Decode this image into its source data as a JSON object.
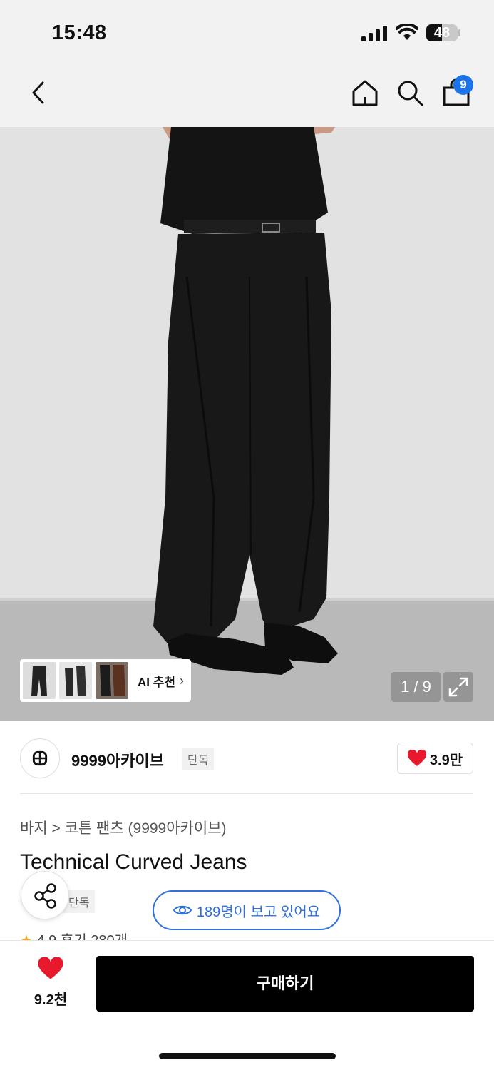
{
  "status_bar": {
    "time": "15:48",
    "battery": "48"
  },
  "nav": {
    "cart_count": "9",
    "icons": [
      "back-icon",
      "home-icon",
      "search-icon",
      "cart-icon"
    ]
  },
  "gallery": {
    "ai_label": "AI 추천",
    "counter": "1 / 9"
  },
  "brand": {
    "name": "9999아카이브",
    "tag": "단독",
    "likes": "3.9만"
  },
  "product": {
    "breadcrumb": "바지 > 코튼 팬츠 (9999아카이브)",
    "title": "Technical Curved Jeans",
    "exclusive": "단독",
    "viewers": "189명이 보고 있어요",
    "rating_text": "4.9  후기 280개"
  },
  "bottom_bar": {
    "wish_count": "9.2천",
    "buy_label": "구매하기"
  },
  "colors": {
    "accent": "#2f6fde",
    "heart": "#e8192c",
    "buy_button": "#000000",
    "badge": "#1a73e8"
  }
}
